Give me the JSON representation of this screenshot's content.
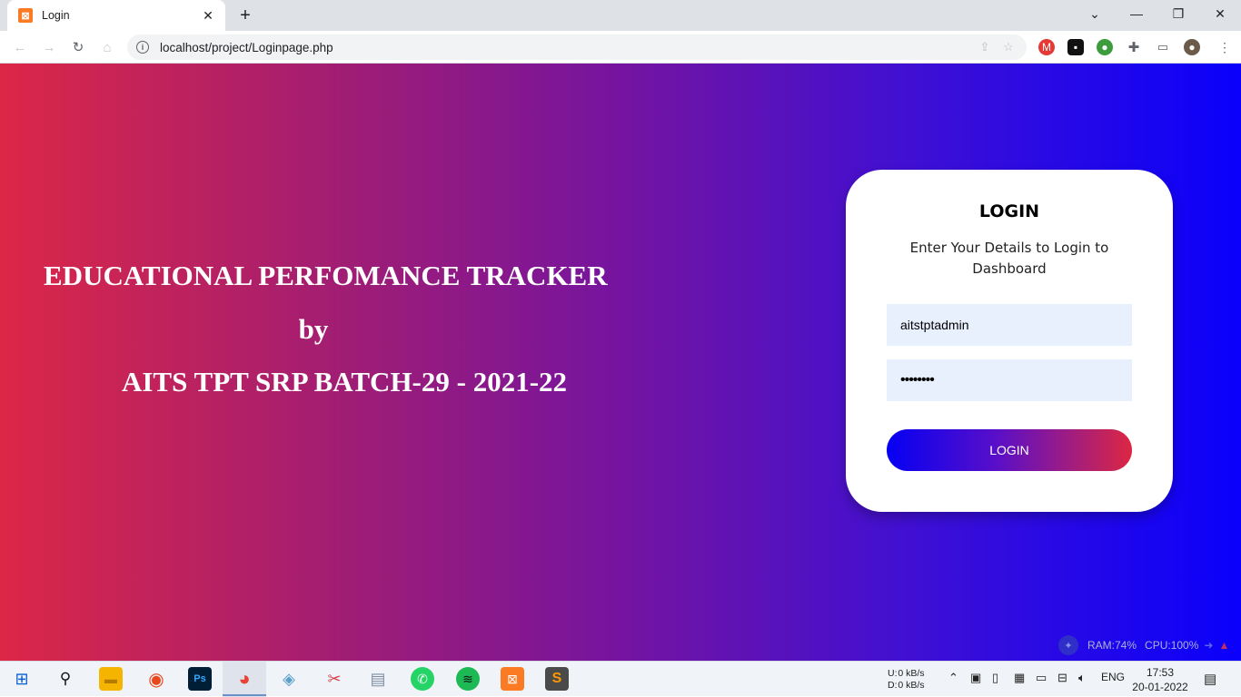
{
  "browser": {
    "tab_title": "Login",
    "tab_favicon": "xampp-icon",
    "url": "localhost/project/Loginpage.php"
  },
  "hero": {
    "line1": "EDUCATIONAL PERFOMANCE TRACKER",
    "line2": "by",
    "line3": "AITS TPT SRP BATCH-29 - 2021-22"
  },
  "login": {
    "title": "LOGIN",
    "subtitle": "Enter Your Details to Login to Dashboard",
    "username_value": "aitstptadmin",
    "password_value": "••••••••",
    "button_label": "LOGIN"
  },
  "sysmon": {
    "ram": "RAM:74%",
    "cpu": "CPU:100%"
  },
  "taskbar": {
    "net_up_label": "U:",
    "net_down_label": "D:",
    "net_up_value": "0 kB/s",
    "net_down_value": "0 kB/s",
    "language": "ENG",
    "time": "17:53",
    "date": "20-01-2022"
  },
  "colors": {
    "gradient_left": "#dc2747",
    "gradient_right": "#0a00fb",
    "field_bg": "#e8f0fe"
  }
}
